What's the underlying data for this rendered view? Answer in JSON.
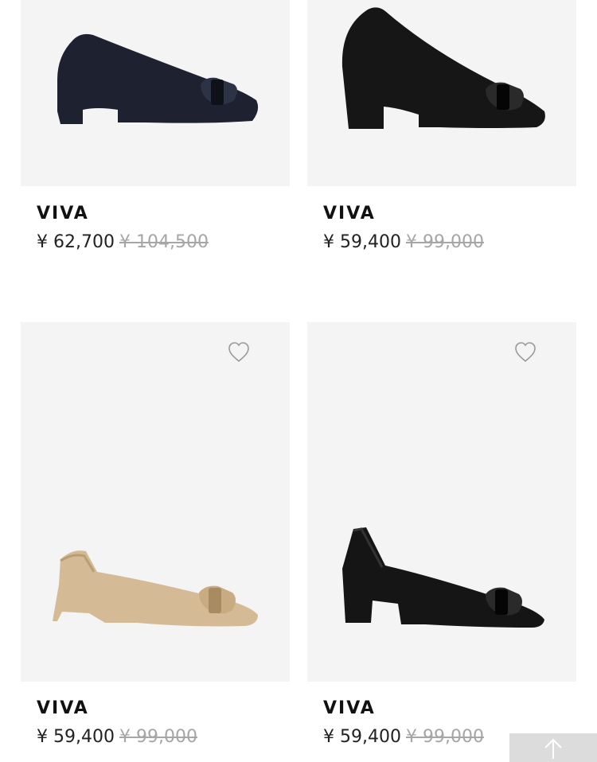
{
  "products": [
    {
      "name": "VIVA",
      "price": "¥ 62,700",
      "original_price": "¥ 104,500",
      "shoe_color": "#1e2230"
    },
    {
      "name": "VIVA",
      "price": "¥ 59,400",
      "original_price": "¥ 99,000",
      "shoe_color": "#161616"
    },
    {
      "name": "VIVA",
      "price": "¥ 59,400",
      "original_price": "¥ 99,000",
      "shoe_color": "#d4bb95"
    },
    {
      "name": "VIVA",
      "price": "¥ 59,400",
      "original_price": "¥ 99,000",
      "shoe_color": "#151515"
    }
  ],
  "icons": {
    "wishlist": "heart-outline-icon",
    "back_to_top": "arrow-up-icon"
  },
  "colors": {
    "card_background": "#f4f4f4",
    "original_price": "#a6a6a6",
    "back_to_top_background": "#dcdcdc"
  }
}
